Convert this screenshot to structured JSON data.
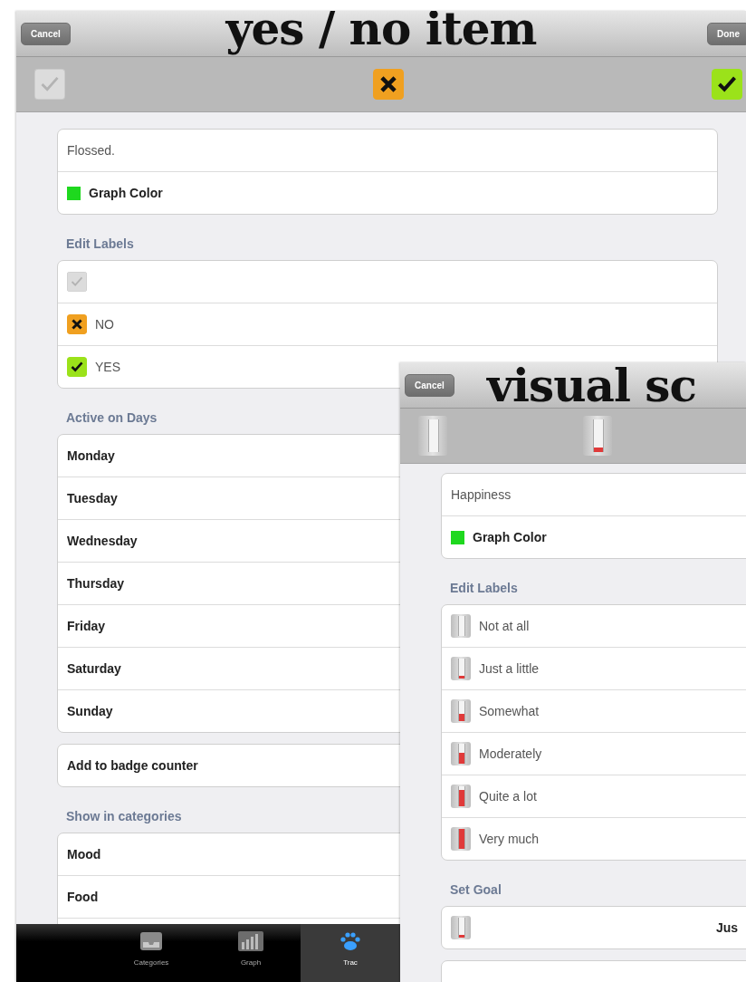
{
  "screens": [
    {
      "caption": "yes / no item",
      "cancel": "Cancel",
      "done": "Done",
      "toolbar": [
        {
          "kind": "blank"
        },
        {
          "kind": "no"
        },
        {
          "kind": "yes"
        }
      ],
      "groups": [
        {
          "rows": [
            {
              "kind": "field",
              "text": "Flossed."
            },
            {
              "kind": "color",
              "text": "Graph Color",
              "color": "#1ed81e"
            }
          ]
        },
        {
          "header": "Edit Labels",
          "rows": [
            {
              "kind": "blank"
            },
            {
              "kind": "no",
              "text": "NO"
            },
            {
              "kind": "yes",
              "text": "YES"
            }
          ]
        },
        {
          "header": "Active on Days",
          "rows": [
            {
              "kind": "bold",
              "text": "Monday"
            },
            {
              "kind": "bold",
              "text": "Tuesday"
            },
            {
              "kind": "bold",
              "text": "Wednesday"
            },
            {
              "kind": "bold",
              "text": "Thursday"
            },
            {
              "kind": "bold",
              "text": "Friday"
            },
            {
              "kind": "bold",
              "text": "Saturday"
            },
            {
              "kind": "bold",
              "text": "Sunday"
            }
          ]
        },
        {
          "rows": [
            {
              "kind": "bold",
              "text": "Add to badge counter"
            }
          ]
        },
        {
          "header": "Show in categories",
          "rows": [
            {
              "kind": "bold",
              "text": "Mood"
            },
            {
              "kind": "bold",
              "text": "Food"
            },
            {
              "kind": "empty"
            }
          ]
        }
      ],
      "tabbar": [
        {
          "kind": "tray",
          "label": "Categories",
          "selected": false
        },
        {
          "kind": "chart",
          "label": "Graph",
          "selected": false
        },
        {
          "kind": "paw",
          "label": "Trac",
          "selected": true
        }
      ]
    },
    {
      "caption": "visual sc",
      "cancel": "Cancel",
      "toolbar": [
        {
          "kind": "scale",
          "level": 0
        },
        {
          "kind": "scale",
          "level": 0.15
        }
      ],
      "groups": [
        {
          "rows": [
            {
              "kind": "field",
              "text": "Happiness"
            },
            {
              "kind": "color",
              "text": "Graph Color",
              "color": "#1ed81e"
            }
          ]
        },
        {
          "header": "Edit Labels",
          "rows": [
            {
              "kind": "scale",
              "level": 0,
              "text": "Not at all"
            },
            {
              "kind": "scale",
              "level": 0.15,
              "text": "Just a little"
            },
            {
              "kind": "scale",
              "level": 0.35,
              "text": "Somewhat"
            },
            {
              "kind": "scale",
              "level": 0.55,
              "text": "Moderately"
            },
            {
              "kind": "scale",
              "level": 0.8,
              "text": "Quite a lot"
            },
            {
              "kind": "scale",
              "level": 1,
              "text": "Very much"
            }
          ]
        },
        {
          "header": "Set Goal",
          "rows": [
            {
              "kind": "goal",
              "level": 0.15,
              "value": "Jus"
            }
          ]
        },
        {
          "rows": [
            {
              "kind": "empty"
            }
          ]
        }
      ]
    }
  ]
}
